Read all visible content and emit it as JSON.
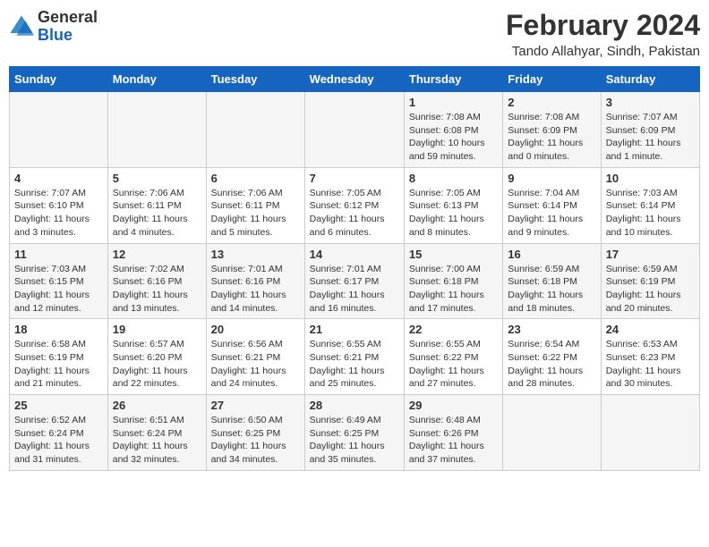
{
  "header": {
    "logo_line1": "General",
    "logo_line2": "Blue",
    "title": "February 2024",
    "subtitle": "Tando Allahyar, Sindh, Pakistan"
  },
  "columns": [
    "Sunday",
    "Monday",
    "Tuesday",
    "Wednesday",
    "Thursday",
    "Friday",
    "Saturday"
  ],
  "weeks": [
    [
      {
        "day": "",
        "info": ""
      },
      {
        "day": "",
        "info": ""
      },
      {
        "day": "",
        "info": ""
      },
      {
        "day": "",
        "info": ""
      },
      {
        "day": "1",
        "info": "Sunrise: 7:08 AM\nSunset: 6:08 PM\nDaylight: 10 hours\nand 59 minutes."
      },
      {
        "day": "2",
        "info": "Sunrise: 7:08 AM\nSunset: 6:09 PM\nDaylight: 11 hours\nand 0 minutes."
      },
      {
        "day": "3",
        "info": "Sunrise: 7:07 AM\nSunset: 6:09 PM\nDaylight: 11 hours\nand 1 minute."
      }
    ],
    [
      {
        "day": "4",
        "info": "Sunrise: 7:07 AM\nSunset: 6:10 PM\nDaylight: 11 hours\nand 3 minutes."
      },
      {
        "day": "5",
        "info": "Sunrise: 7:06 AM\nSunset: 6:11 PM\nDaylight: 11 hours\nand 4 minutes."
      },
      {
        "day": "6",
        "info": "Sunrise: 7:06 AM\nSunset: 6:11 PM\nDaylight: 11 hours\nand 5 minutes."
      },
      {
        "day": "7",
        "info": "Sunrise: 7:05 AM\nSunset: 6:12 PM\nDaylight: 11 hours\nand 6 minutes."
      },
      {
        "day": "8",
        "info": "Sunrise: 7:05 AM\nSunset: 6:13 PM\nDaylight: 11 hours\nand 8 minutes."
      },
      {
        "day": "9",
        "info": "Sunrise: 7:04 AM\nSunset: 6:14 PM\nDaylight: 11 hours\nand 9 minutes."
      },
      {
        "day": "10",
        "info": "Sunrise: 7:03 AM\nSunset: 6:14 PM\nDaylight: 11 hours\nand 10 minutes."
      }
    ],
    [
      {
        "day": "11",
        "info": "Sunrise: 7:03 AM\nSunset: 6:15 PM\nDaylight: 11 hours\nand 12 minutes."
      },
      {
        "day": "12",
        "info": "Sunrise: 7:02 AM\nSunset: 6:16 PM\nDaylight: 11 hours\nand 13 minutes."
      },
      {
        "day": "13",
        "info": "Sunrise: 7:01 AM\nSunset: 6:16 PM\nDaylight: 11 hours\nand 14 minutes."
      },
      {
        "day": "14",
        "info": "Sunrise: 7:01 AM\nSunset: 6:17 PM\nDaylight: 11 hours\nand 16 minutes."
      },
      {
        "day": "15",
        "info": "Sunrise: 7:00 AM\nSunset: 6:18 PM\nDaylight: 11 hours\nand 17 minutes."
      },
      {
        "day": "16",
        "info": "Sunrise: 6:59 AM\nSunset: 6:18 PM\nDaylight: 11 hours\nand 18 minutes."
      },
      {
        "day": "17",
        "info": "Sunrise: 6:59 AM\nSunset: 6:19 PM\nDaylight: 11 hours\nand 20 minutes."
      }
    ],
    [
      {
        "day": "18",
        "info": "Sunrise: 6:58 AM\nSunset: 6:19 PM\nDaylight: 11 hours\nand 21 minutes."
      },
      {
        "day": "19",
        "info": "Sunrise: 6:57 AM\nSunset: 6:20 PM\nDaylight: 11 hours\nand 22 minutes."
      },
      {
        "day": "20",
        "info": "Sunrise: 6:56 AM\nSunset: 6:21 PM\nDaylight: 11 hours\nand 24 minutes."
      },
      {
        "day": "21",
        "info": "Sunrise: 6:55 AM\nSunset: 6:21 PM\nDaylight: 11 hours\nand 25 minutes."
      },
      {
        "day": "22",
        "info": "Sunrise: 6:55 AM\nSunset: 6:22 PM\nDaylight: 11 hours\nand 27 minutes."
      },
      {
        "day": "23",
        "info": "Sunrise: 6:54 AM\nSunset: 6:22 PM\nDaylight: 11 hours\nand 28 minutes."
      },
      {
        "day": "24",
        "info": "Sunrise: 6:53 AM\nSunset: 6:23 PM\nDaylight: 11 hours\nand 30 minutes."
      }
    ],
    [
      {
        "day": "25",
        "info": "Sunrise: 6:52 AM\nSunset: 6:24 PM\nDaylight: 11 hours\nand 31 minutes."
      },
      {
        "day": "26",
        "info": "Sunrise: 6:51 AM\nSunset: 6:24 PM\nDaylight: 11 hours\nand 32 minutes."
      },
      {
        "day": "27",
        "info": "Sunrise: 6:50 AM\nSunset: 6:25 PM\nDaylight: 11 hours\nand 34 minutes."
      },
      {
        "day": "28",
        "info": "Sunrise: 6:49 AM\nSunset: 6:25 PM\nDaylight: 11 hours\nand 35 minutes."
      },
      {
        "day": "29",
        "info": "Sunrise: 6:48 AM\nSunset: 6:26 PM\nDaylight: 11 hours\nand 37 minutes."
      },
      {
        "day": "",
        "info": ""
      },
      {
        "day": "",
        "info": ""
      }
    ]
  ]
}
